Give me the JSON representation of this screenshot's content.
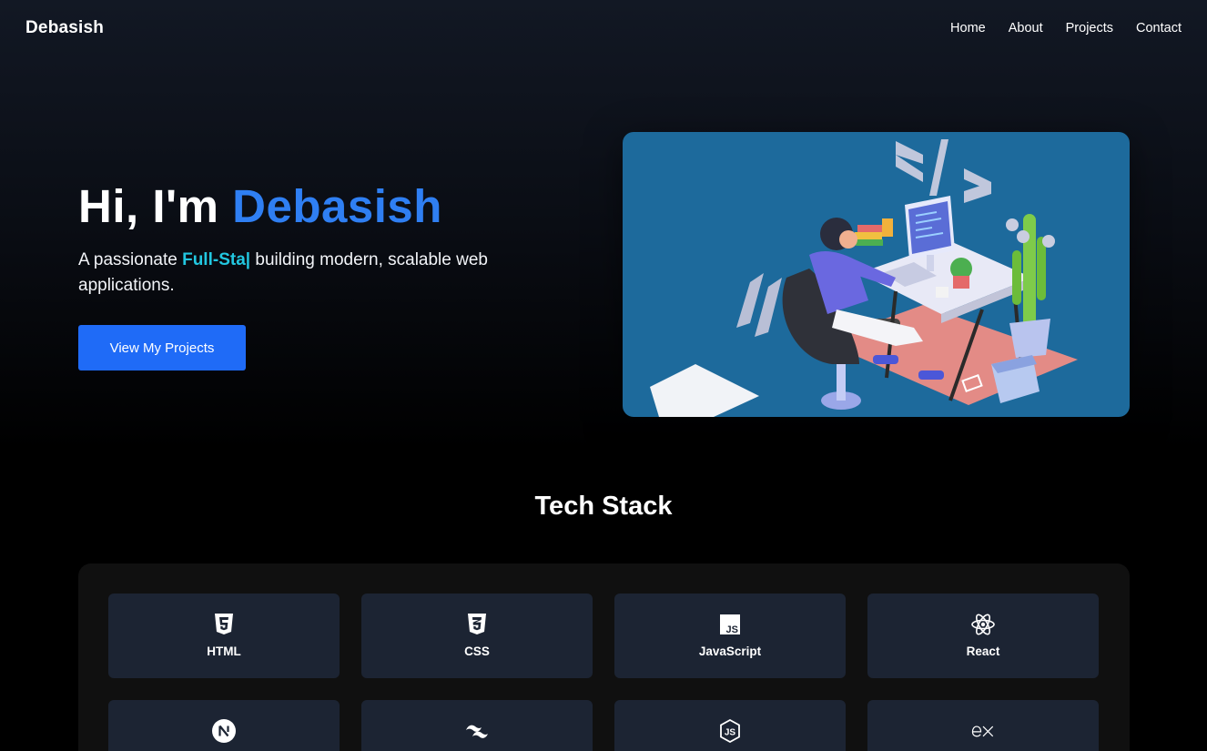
{
  "brand": "Debasish",
  "nav": {
    "items": [
      "Home",
      "About",
      "Projects",
      "Contact"
    ]
  },
  "hero": {
    "greeting": "Hi, I'm ",
    "name": "Debasish",
    "sub_prefix": "A passionate ",
    "typed": "Full-Sta",
    "caret": "|",
    "sub_suffix": " building modern, scalable web applications.",
    "cta": "View My Projects"
  },
  "tech": {
    "title": "Tech Stack",
    "items": [
      {
        "label": "HTML",
        "icon": "html5-icon"
      },
      {
        "label": "CSS",
        "icon": "css3-icon"
      },
      {
        "label": "JavaScript",
        "icon": "javascript-icon"
      },
      {
        "label": "React",
        "icon": "react-icon"
      },
      {
        "label": "",
        "icon": "nextjs-icon"
      },
      {
        "label": "",
        "icon": "tailwind-icon"
      },
      {
        "label": "",
        "icon": "nodejs-icon"
      },
      {
        "label": "",
        "icon": "express-icon"
      }
    ]
  },
  "colors": {
    "accent": "#2f7ff3",
    "typed": "#22c7e0",
    "button": "#1f6bf7",
    "card": "#1c2433"
  }
}
